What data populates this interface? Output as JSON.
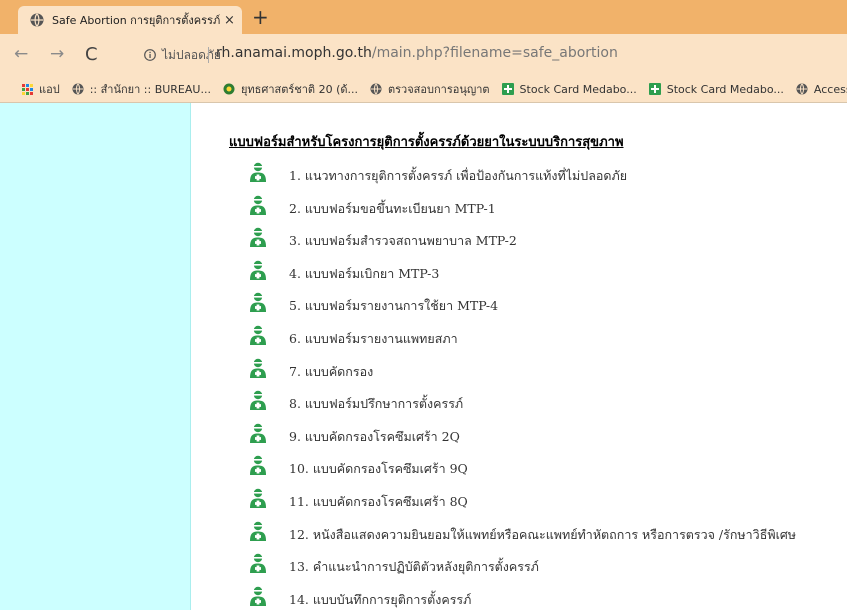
{
  "browser": {
    "tab_title": "Safe Abortion การยุติการตั้งครรภ์ด้ว",
    "tab_close": "×",
    "new_tab": "+",
    "back": "←",
    "forward": "→",
    "reload": "C",
    "security_label": "ไม่ปลอดภัย",
    "url_domain": "rh.anamai.moph.go.th",
    "url_path": "/main.php?filename=safe_abortion"
  },
  "bookmarks": {
    "apps_label": "แอป",
    "items": [
      ":: สำนักยา :: BUREAU...",
      "ยุทธศาสตร์ชาติ 20 (ด้...",
      "ตรวจสอบการอนุญาต",
      "Stock Card Medabo...",
      "Stock Card Medabo...",
      "Access to S"
    ]
  },
  "page": {
    "heading": "แบบฟอร์มสำหรับโครงการยุติการตั้งครรภ์ด้วยยาในระบบบริการสุขภาพ",
    "items": [
      "1. แนวทางการยุติการตั้งครรภ์ เพื่อป้องกันการแท้งที่ไม่ปลอดภัย",
      "2. แบบฟอร์มขอขึ้นทะเบียนยา MTP-1",
      "3. แบบฟอร์มสำรวจสถานพยาบาล MTP-2",
      "4. แบบฟอร์มเบิกยา MTP-3",
      "5. แบบฟอร์มรายงานการใช้ยา MTP-4",
      "6. แบบฟอร์มรายงานแพทยสภา",
      "7. แบบคัดกรอง",
      "8. แบบฟอร์มปรึกษาการตั้งครรภ์",
      "9. แบบคัดกรองโรคซึมเศร้า 2Q",
      "10. แบบคัดกรองโรคซึมเศร้า 9Q",
      "11. แบบคัดกรองโรคซึมเศร้า 8Q",
      "12. หนังสือแสดงความยินยอมให้แพทย์หรือคณะแพทย์ทำหัตถการ หรือการตรวจ /รักษาวิธีพิเศษ",
      "13. คำแนะนำการปฏิบัติตัวหลังยุติการตั้งครรภ์",
      "14. แบบบันทึกการยุติการตั้งครรภ์"
    ]
  },
  "colors": {
    "tabstrip": "#f1b26a",
    "toolbar": "#fbe3c6",
    "sidebar": "#ccffff",
    "icon_green": "#2e9e4f"
  }
}
